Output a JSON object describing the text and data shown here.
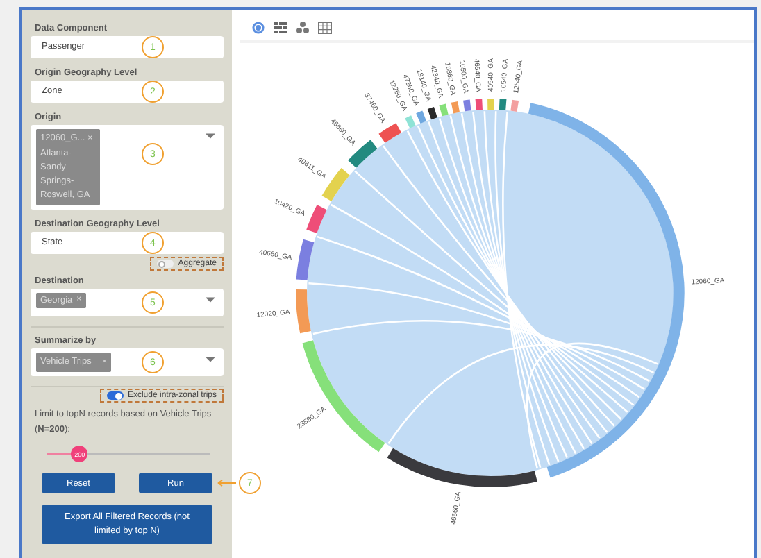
{
  "sidebar": {
    "data_component": {
      "label": "Data Component",
      "value": "Passenger",
      "marker": "1"
    },
    "origin_level": {
      "label": "Origin Geography Level",
      "value": "Zone",
      "marker": "2"
    },
    "origin": {
      "label": "Origin",
      "tag_code": "12060_G...",
      "tag_remove": "×",
      "tag_name": "Atlanta-Sandy Springs-Roswell, GA",
      "marker": "3"
    },
    "destination_level": {
      "label": "Destination Geography Level",
      "value": "State",
      "marker": "4"
    },
    "aggregate": {
      "label": "Aggregate",
      "on": false
    },
    "destination": {
      "label": "Destination",
      "tag": "Georgia",
      "tag_remove": "×",
      "marker": "5"
    },
    "summarize": {
      "label": "Summarize by",
      "tag": "Vehicle Trips",
      "tag_remove": "×",
      "marker": "6"
    },
    "exclude_intrazonal": {
      "label": "Exclude intra-zonal trips",
      "on": true
    },
    "limit_text": "Limit to topN records based on Vehicle Trips (**N=200**):",
    "slider": {
      "level": 0.2,
      "value": "200"
    },
    "buttons": [
      {
        "label": "Reset",
        "kind": "small"
      },
      {
        "label": "Run",
        "kind": "small",
        "marker": "7"
      },
      {
        "label": "Export All Filtered Records (not limited by top N)",
        "kind": "wide"
      }
    ]
  },
  "toolbar": {
    "views": [
      {
        "selected": true
      },
      {
        "selected": false
      },
      {
        "selected": false
      },
      {
        "selected": false
      }
    ]
  },
  "chord_groups": [
    {
      "label": "12060_GA",
      "color": "#7fb3e8"
    },
    {
      "label": "46660_GA",
      "color": "#3a3a3e"
    },
    {
      "label": "23580_GA",
      "color": "#86e07a"
    },
    {
      "label": "12020_GA",
      "color": "#f39a55"
    },
    {
      "label": "40660_GA",
      "color": "#7b7fe0"
    },
    {
      "label": "10420_GA",
      "color": "#ee4e78"
    },
    {
      "label": "40611_GA",
      "color": "#e3d24e"
    },
    {
      "label": "46660_GA",
      "color": "#238a80"
    },
    {
      "label": "37460_GA",
      "color": "#ee5252"
    },
    {
      "label": "12260_GA",
      "color": "#8fe3d6"
    },
    {
      "label": "47260_GA",
      "color": "#6fa8e0"
    },
    {
      "label": "19140_GA",
      "color": "#2a2a2a"
    },
    {
      "label": "42340_GA",
      "color": "#86e07a"
    },
    {
      "label": "16860_GA",
      "color": "#f39a55"
    },
    {
      "label": "10500_GA",
      "color": "#7b7fe0"
    },
    {
      "label": "46540_GA",
      "color": "#ee4e78"
    },
    {
      "label": "40540_GA",
      "color": "#e3d24e"
    },
    {
      "label": "10540_GA",
      "color": "#238a80"
    },
    {
      "label": "12540_GA",
      "color": "#f3a0a0"
    }
  ]
}
